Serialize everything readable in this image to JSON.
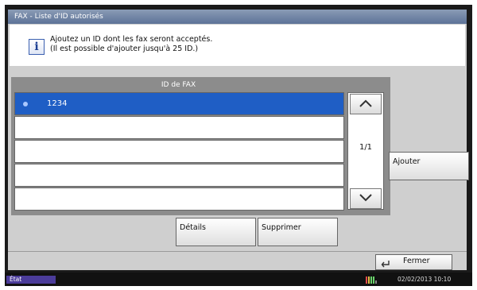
{
  "window": {
    "title": "FAX - Liste d'ID autorisés"
  },
  "info": {
    "icon": "info-icon",
    "line1": "Ajoutez un ID dont les fax seront acceptés.",
    "line2": "(Il est possible d'ajouter jusqu'à 25 ID.)"
  },
  "list": {
    "header": "ID de FAX",
    "rows": [
      "1234",
      "",
      "",
      "",
      ""
    ],
    "selected_index": 0,
    "page_indicator": "1/1"
  },
  "buttons": {
    "add": "Ajouter",
    "details": "Détails",
    "delete": "Supprimer",
    "close": "Fermer"
  },
  "status": {
    "state": "État",
    "datetime": "02/02/2013 10:10"
  },
  "colors": {
    "selected_row": "#1f5ec5",
    "title_bar": "#5d7398",
    "state_badge": "#4b3c9a"
  }
}
